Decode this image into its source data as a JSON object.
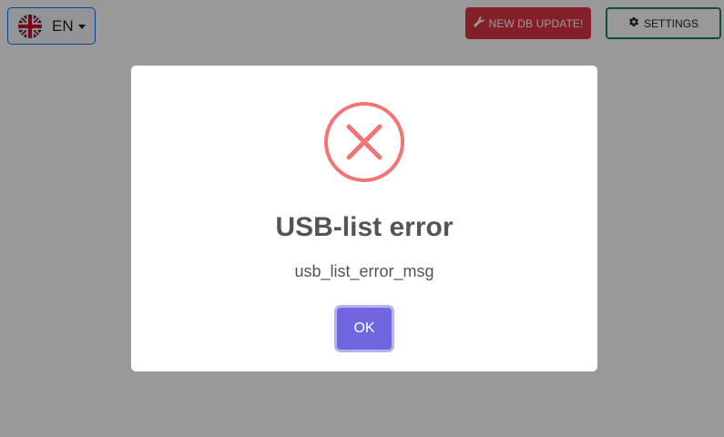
{
  "toolbar": {
    "language_label": "EN",
    "language_flag_icon": "uk-flag-icon",
    "update_label": "NEW DB UPDATE!",
    "update_icon": "wrench-icon",
    "settings_label": "SETTINGS",
    "settings_icon": "gear-icon"
  },
  "dialog": {
    "icon": "error-x-icon",
    "title": "USB-list error",
    "message": "usb_list_error_msg",
    "ok_label": "OK"
  },
  "colors": {
    "error_icon": "#f27474",
    "update_button": "#dc3545",
    "settings_border": "#198754",
    "ok_button": "#7066e0",
    "backdrop": "rgba(0,0,0,0.4)"
  }
}
